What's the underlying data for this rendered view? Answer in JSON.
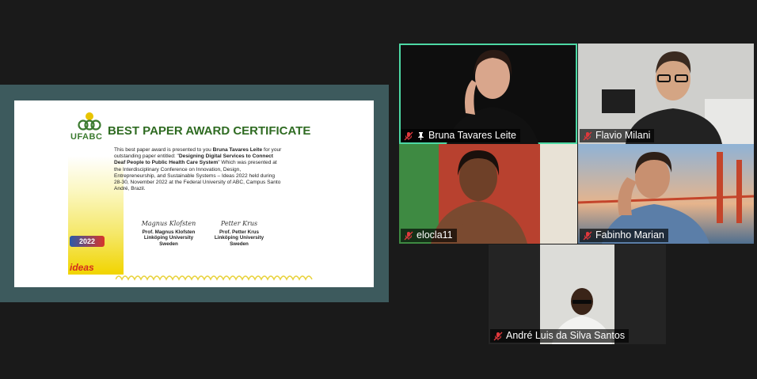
{
  "certificate": {
    "org": "UFABC",
    "title": "BEST PAPER AWARD CERTIFICATE",
    "body_intro": "This best paper award is presented to you ",
    "recipient": "Bruna Tavares Leite",
    "body_mid": " for your outstanding paper entitled: \"",
    "paper_title": "Designing Digital Services to Connect Deaf People to Public Health Care System",
    "body_rest": "\" Which was presented at the Interdisciplinary Conference on Innovation, Design, Entrepreneurship, and Sustainable Systems – Ideas 2022 held during 28-30, November 2022 at the Federal University of ABC, Campus Santo André, Brazil.",
    "badge_year": "2022",
    "ideas_logo": "ideas",
    "signatures": [
      {
        "script": "Magnus Klofsten",
        "name": "Prof. Magnus Klofsten",
        "institution": "Linköping University",
        "country": "Sweden"
      },
      {
        "script": "Petter Krus",
        "name": "Prof. Petter Krus",
        "institution": "Linköping University",
        "country": "Sweden"
      }
    ]
  },
  "participants": [
    {
      "name": "Bruna Tavares Leite",
      "muted": true,
      "pinned": true,
      "active_speaker": true
    },
    {
      "name": "Flavio Milani",
      "muted": true,
      "pinned": false,
      "active_speaker": false
    },
    {
      "name": "elocla11",
      "muted": true,
      "pinned": false,
      "active_speaker": false
    },
    {
      "name": "Fabinho Marian",
      "muted": true,
      "pinned": false,
      "active_speaker": false
    },
    {
      "name": "André Luis da Silva Santos",
      "muted": true,
      "pinned": false,
      "active_speaker": false
    }
  ],
  "colors": {
    "active_border": "#4dd8a4",
    "muted_icon": "#e0383c",
    "share_background": "#3d5a5d",
    "certificate_title": "#2f6b22"
  }
}
